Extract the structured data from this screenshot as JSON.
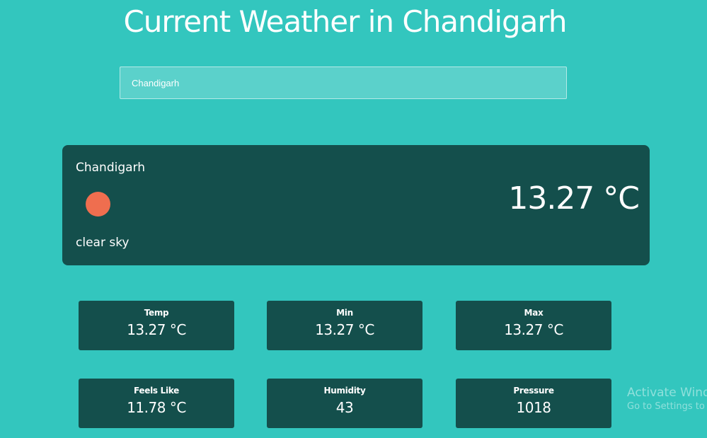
{
  "header": {
    "title": "Current Weather in Chandigarh"
  },
  "search": {
    "value": "Chandigarh",
    "placeholder": ""
  },
  "current": {
    "city": "Chandigarh",
    "icon": "sun-icon",
    "description": "clear sky",
    "temperature": "13.27 °C",
    "colors": {
      "card": "#144f4c",
      "sun": "#ef6e4f",
      "background": "#33c6be"
    }
  },
  "stats": {
    "temp": {
      "label": "Temp",
      "value": "13.27 °C"
    },
    "min": {
      "label": "Min",
      "value": "13.27 °C"
    },
    "max": {
      "label": "Max",
      "value": "13.27 °C"
    },
    "feels_like": {
      "label": "Feels Like",
      "value": "11.78 °C"
    },
    "humidity": {
      "label": "Humidity",
      "value": "43"
    },
    "pressure": {
      "label": "Pressure",
      "value": "1018"
    }
  },
  "watermark": {
    "title": "Activate Windows",
    "subtitle": "Go to Settings to activate Windows."
  }
}
